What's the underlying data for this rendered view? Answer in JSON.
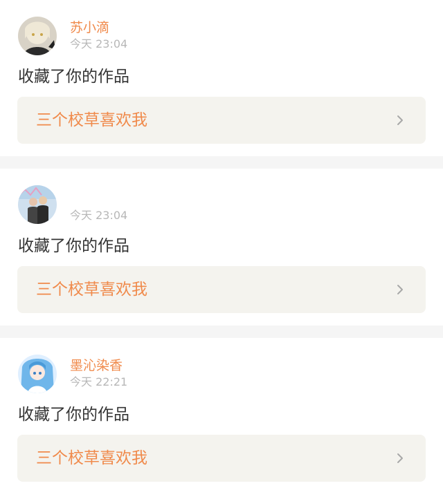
{
  "notifications": [
    {
      "username": "苏小滴",
      "time": "今天 23:04",
      "action": "收藏了你的作品",
      "work_title": "三个校草喜欢我",
      "avatar_icon": "anime-girl-avatar-icon"
    },
    {
      "username": "",
      "time": "今天 23:04",
      "action": "收藏了你的作品",
      "work_title": "三个校草喜欢我",
      "avatar_icon": "couple-photo-avatar-icon"
    },
    {
      "username": "墨沁染香",
      "time": "今天 22:21",
      "action": "收藏了你的作品",
      "work_title": "三个校草喜欢我",
      "avatar_icon": "blue-anime-avatar-icon"
    }
  ],
  "colors": {
    "accent": "#f08a4b",
    "muted_text": "#b7b7b7",
    "body_text": "#333333",
    "link_box_bg": "#f4f3ee",
    "page_bg": "#f5f5f5"
  },
  "icons": {
    "chevron": "chevron-right-icon"
  }
}
